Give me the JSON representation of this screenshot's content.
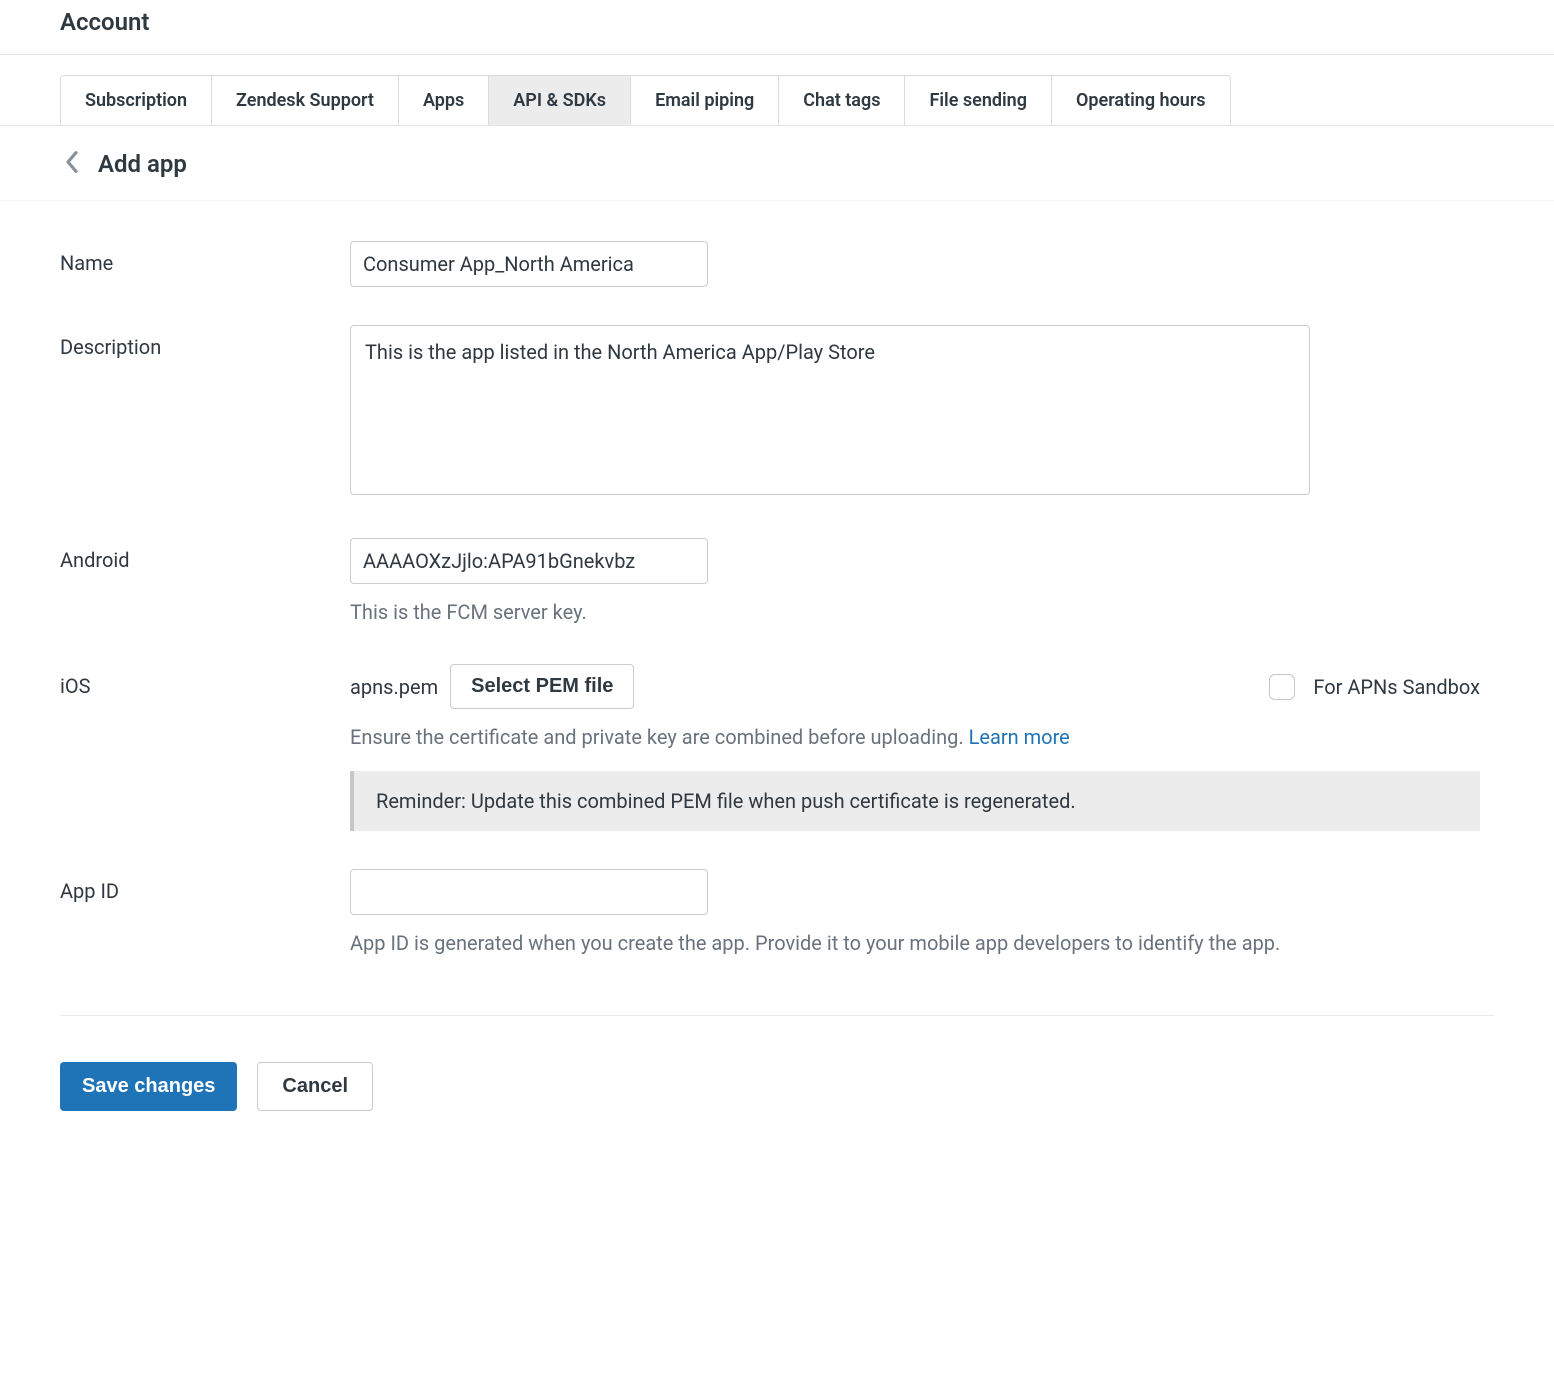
{
  "header": {
    "title": "Account"
  },
  "tabs": {
    "items": [
      {
        "label": "Subscription"
      },
      {
        "label": "Zendesk Support"
      },
      {
        "label": "Apps"
      },
      {
        "label": "API & SDKs"
      },
      {
        "label": "Email piping"
      },
      {
        "label": "Chat tags"
      },
      {
        "label": "File sending"
      },
      {
        "label": "Operating hours"
      }
    ],
    "activeIndex": 3
  },
  "subheader": {
    "title": "Add app"
  },
  "form": {
    "name": {
      "label": "Name",
      "value": "Consumer App_North America"
    },
    "description": {
      "label": "Description",
      "value": "This is the app listed in the North America App/Play Store"
    },
    "android": {
      "label": "Android",
      "value": "AAAAOXzJjlo:APA91bGnekvbz",
      "help": "This is the FCM server key."
    },
    "ios": {
      "label": "iOS",
      "pemFilename": "apns.pem",
      "selectBtn": "Select PEM file",
      "sandboxLabel": "For APNs Sandbox",
      "helpPrefix": "Ensure the certificate and private key are combined before uploading. ",
      "learnMore": "Learn more",
      "reminder": "Reminder: Update this combined PEM file when push certificate is regenerated."
    },
    "appId": {
      "label": "App ID",
      "value": "",
      "help": "App ID is generated when you create the app. Provide it to your mobile app developers to identify the app."
    }
  },
  "footer": {
    "save": "Save changes",
    "cancel": "Cancel"
  }
}
